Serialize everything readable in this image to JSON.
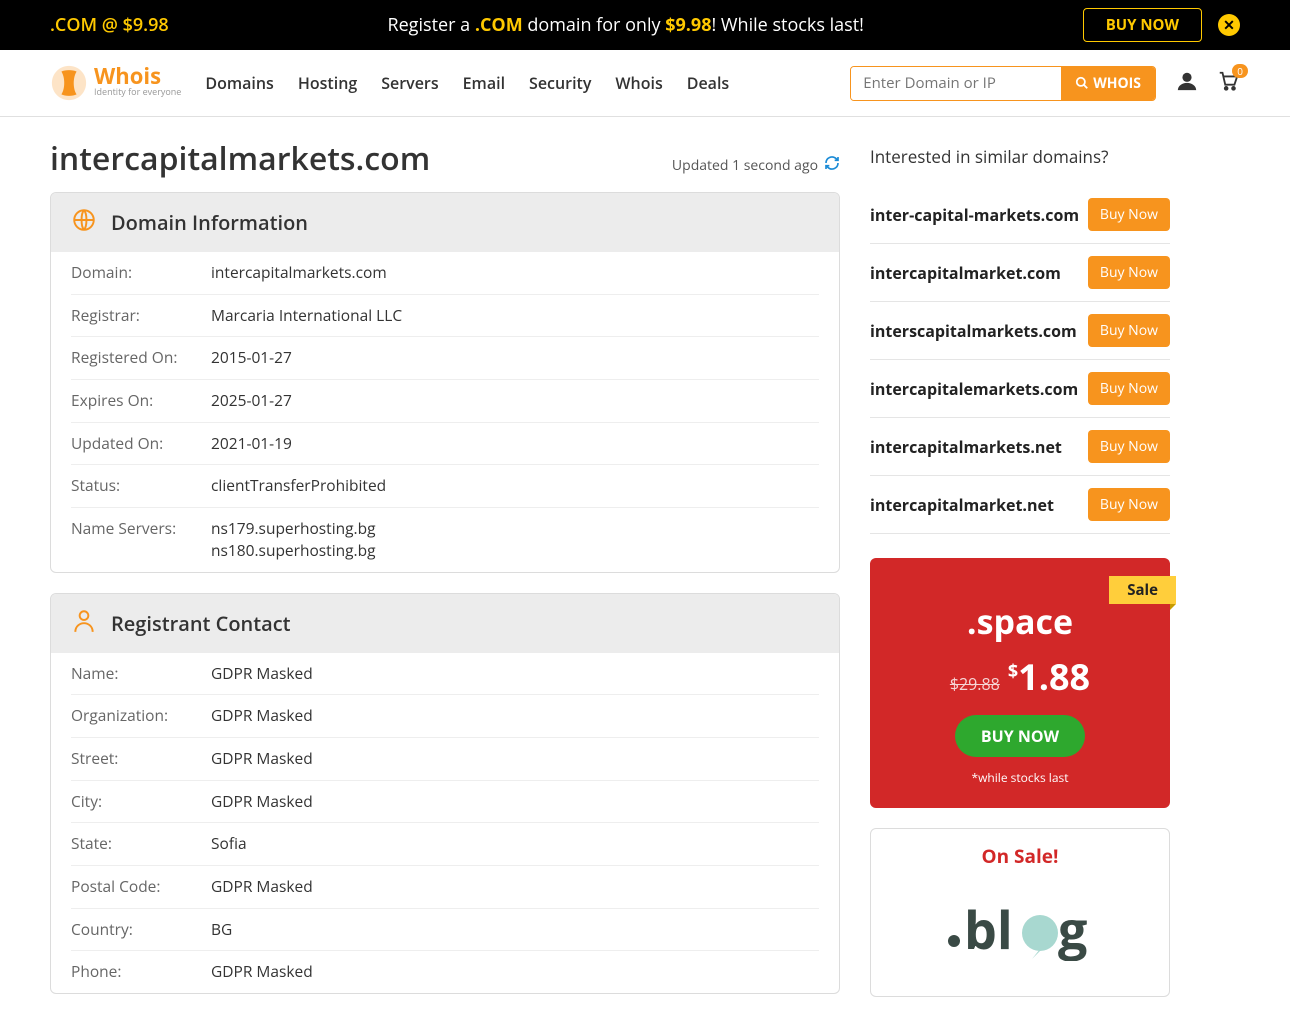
{
  "promo": {
    "left": ".COM @ $9.98",
    "text1": "Register a ",
    "span1": ".COM",
    "text2": " domain for only ",
    "span2": "$9.98",
    "text3": "! While stocks last!",
    "buy": "BUY NOW"
  },
  "logo": {
    "name": "Whois",
    "tag": "Identity for everyone"
  },
  "nav": [
    "Domains",
    "Hosting",
    "Servers",
    "Email",
    "Security",
    "Whois",
    "Deals"
  ],
  "search": {
    "placeholder": "Enter Domain or IP",
    "button": "WHOIS"
  },
  "cart_count": "0",
  "page": {
    "title": "intercapitalmarkets.com",
    "updated": "Updated 1 second ago"
  },
  "domain_info": {
    "heading": "Domain Information",
    "rows": [
      {
        "l": "Domain:",
        "v": "intercapitalmarkets.com"
      },
      {
        "l": "Registrar:",
        "v": "Marcaria International LLC"
      },
      {
        "l": "Registered On:",
        "v": "2015-01-27"
      },
      {
        "l": "Expires On:",
        "v": "2025-01-27"
      },
      {
        "l": "Updated On:",
        "v": "2021-01-19"
      },
      {
        "l": "Status:",
        "v": "clientTransferProhibited"
      },
      {
        "l": "Name Servers:",
        "v": "ns179.superhosting.bg\nns180.superhosting.bg"
      }
    ]
  },
  "registrant": {
    "heading": "Registrant Contact",
    "rows": [
      {
        "l": "Name:",
        "v": "GDPR Masked"
      },
      {
        "l": "Organization:",
        "v": "GDPR Masked"
      },
      {
        "l": "Street:",
        "v": "GDPR Masked"
      },
      {
        "l": "City:",
        "v": "GDPR Masked"
      },
      {
        "l": "State:",
        "v": "Sofia"
      },
      {
        "l": "Postal Code:",
        "v": "GDPR Masked"
      },
      {
        "l": "Country:",
        "v": "BG"
      },
      {
        "l": "Phone:",
        "v": "GDPR Masked"
      }
    ]
  },
  "similar": {
    "title": "Interested in similar domains?",
    "buy": "Buy Now",
    "items": [
      "inter-capital-markets.com",
      "intercapitalmarket.com",
      "interscapitalmarkets.com",
      "intercapitalemarkets.com",
      "intercapitalmarkets.net",
      "intercapitalmarket.net"
    ]
  },
  "sale": {
    "tag": "Sale",
    "domain": ".space",
    "old": "$29.88",
    "new_cur": "$",
    "new": "1.88",
    "buy": "BUY NOW",
    "note": "*while stocks last"
  },
  "onsale": {
    "title": "On Sale!",
    "blog": ".blog"
  }
}
